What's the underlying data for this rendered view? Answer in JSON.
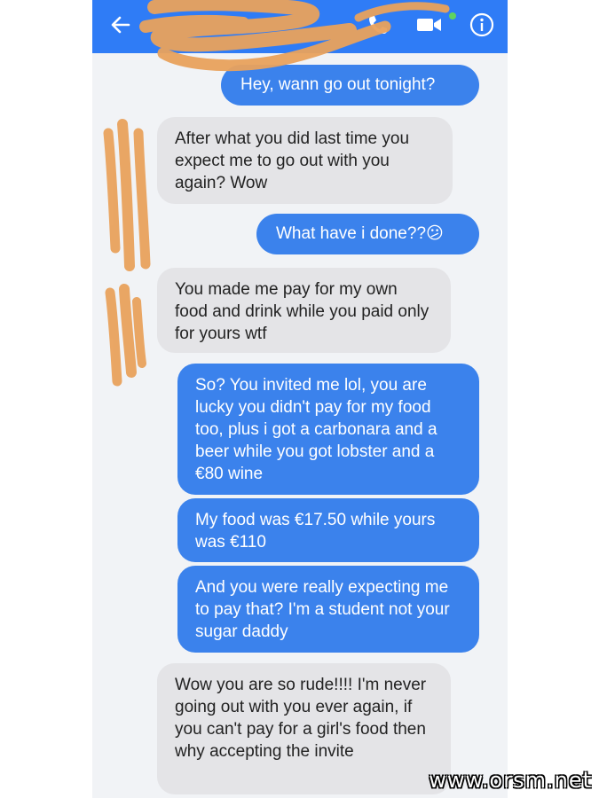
{
  "header": {
    "back_icon": "arrow-left-icon",
    "call_icon": "phone-icon",
    "video_icon": "video-camera-icon",
    "info_icon": "info-icon",
    "bar_color": "#2f7cf6"
  },
  "colors": {
    "outgoing_bubble": "#3b82ec",
    "incoming_bubble": "#e4e4e7"
  },
  "messages": [
    {
      "side": "out",
      "text": "Hey, wann go out tonight?"
    },
    {
      "side": "in",
      "text": "After what you did last time you expect me to go out with you again? Wow"
    },
    {
      "side": "out",
      "text": "What have i done??",
      "emoji": "😕"
    },
    {
      "side": "in",
      "text": "You made me pay for my own food and drink while you paid only for yours wtf"
    },
    {
      "side": "out",
      "text": "So? You invited me  lol, you are lucky you didn't pay for my food too, plus i got a carbonara and a beer while you got lobster and a €80 wine"
    },
    {
      "side": "out",
      "text": "My food was €17.50 while yours was €110"
    },
    {
      "side": "out",
      "text": "And you were really expecting me to pay that? I'm a student not your sugar daddy"
    },
    {
      "side": "in",
      "text": "Wow you are so rude!!!! I'm never going out with you ever again, if you can't pay for a girl's food then why accepting the invite"
    }
  ],
  "watermark": "www.orsm.net"
}
